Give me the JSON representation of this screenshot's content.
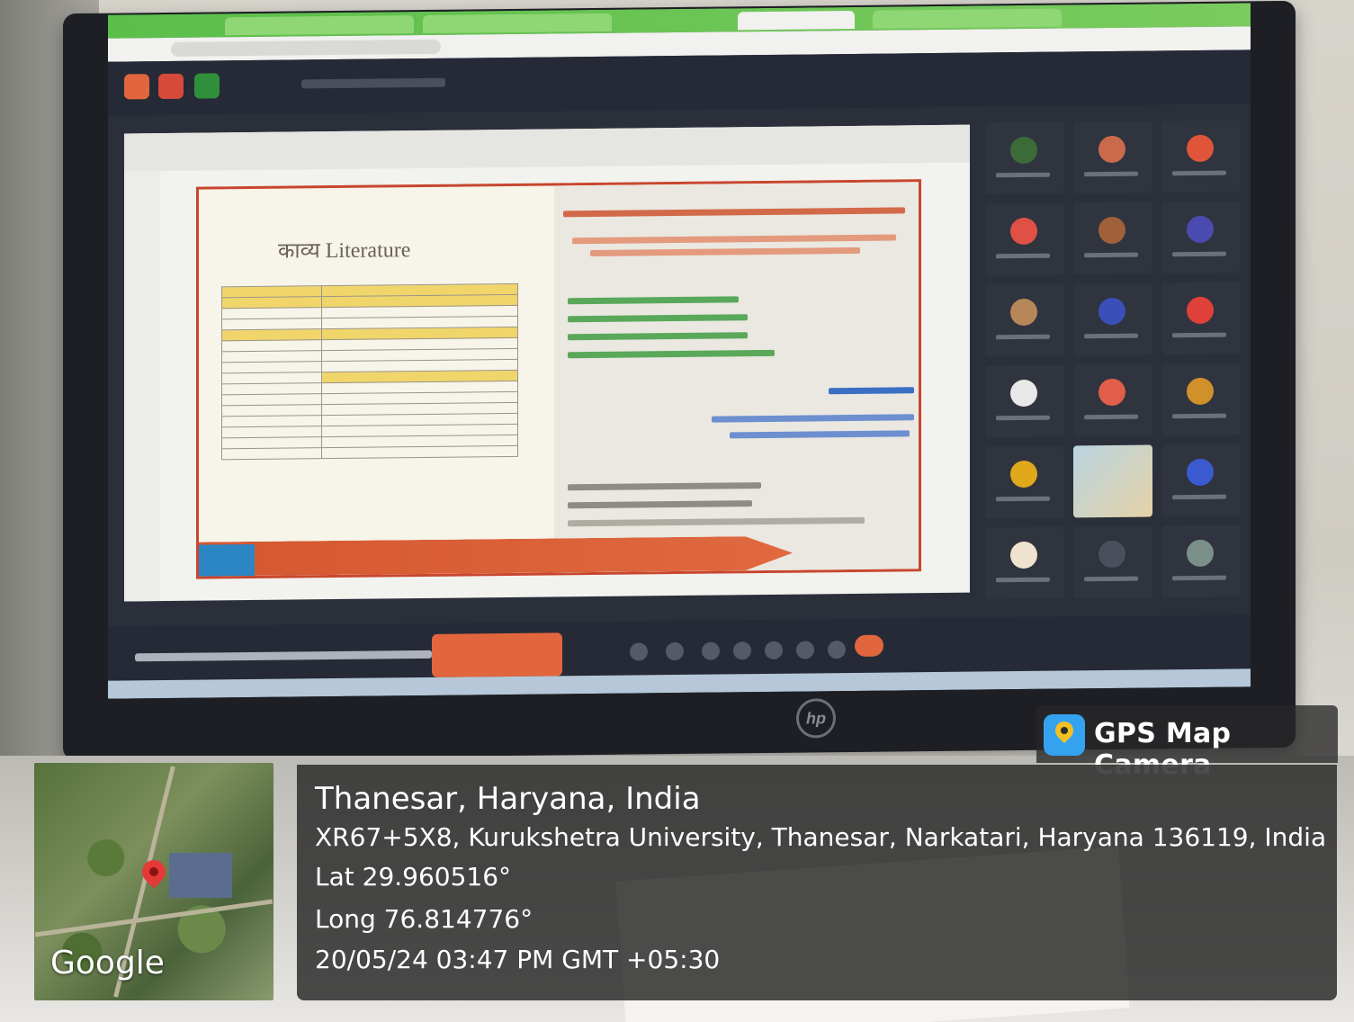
{
  "photo": {
    "screen_slide_title": "काव्य Literature",
    "monitor_brand": "hp"
  },
  "overlay": {
    "brand_name": "GPS Map Camera",
    "map_label": "Google",
    "location_title": "Thanesar, Haryana, India",
    "address": "XR67+5X8, Kurukshetra University, Thanesar, Narkatari, Haryana 136119, India",
    "latitude": "Lat 29.960516°",
    "longitude": "Long 76.814776°",
    "datetime": "20/05/24 03:47 PM GMT +05:30"
  },
  "colors": {
    "overlay_bg": "#262626",
    "pin": "#e53935",
    "brand_icon": "#35a2f0",
    "accent_orange": "#e2663d"
  }
}
